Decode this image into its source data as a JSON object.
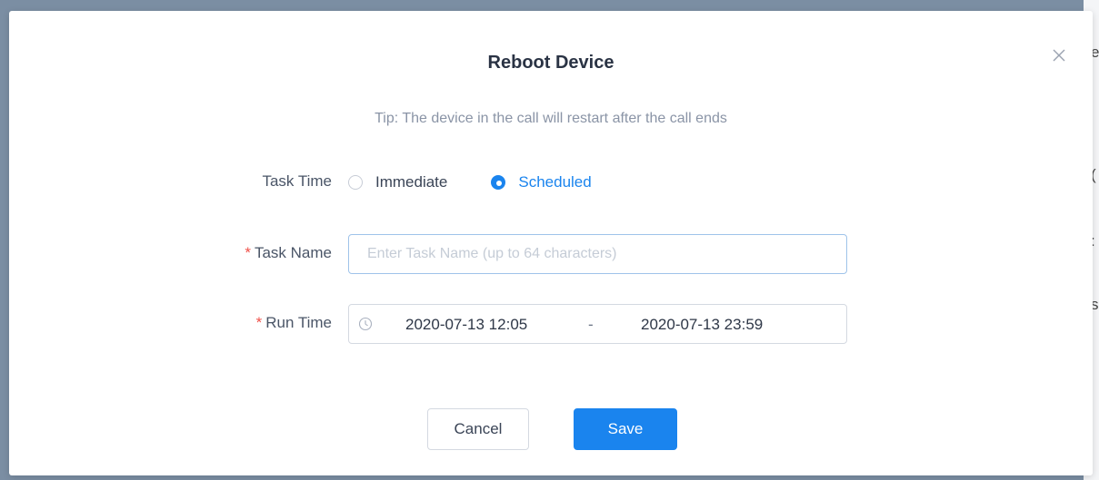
{
  "background_page": {
    "peek_chars": [
      "e",
      "(",
      ":",
      "s"
    ]
  },
  "dialog": {
    "title": "Reboot Device",
    "close_icon": "close-icon",
    "tip": "Tip: The device in the call will restart after the call ends",
    "task_time": {
      "label": "Task Time",
      "options": [
        {
          "label": "Immediate",
          "checked": false
        },
        {
          "label": "Scheduled",
          "checked": true
        }
      ]
    },
    "task_name": {
      "required_mark": "*",
      "label": "Task Name",
      "value": "",
      "placeholder": "Enter Task Name (up to 64 characters)"
    },
    "run_time": {
      "required_mark": "*",
      "label": "Run Time",
      "icon": "clock-icon",
      "start": "2020-07-13 12:05",
      "separator": "-",
      "end": "2020-07-13 23:59"
    },
    "buttons": {
      "cancel": "Cancel",
      "save": "Save"
    }
  },
  "colors": {
    "accent": "#1a84ee",
    "required": "#f0524b",
    "overlay": "#7b8ea3"
  }
}
